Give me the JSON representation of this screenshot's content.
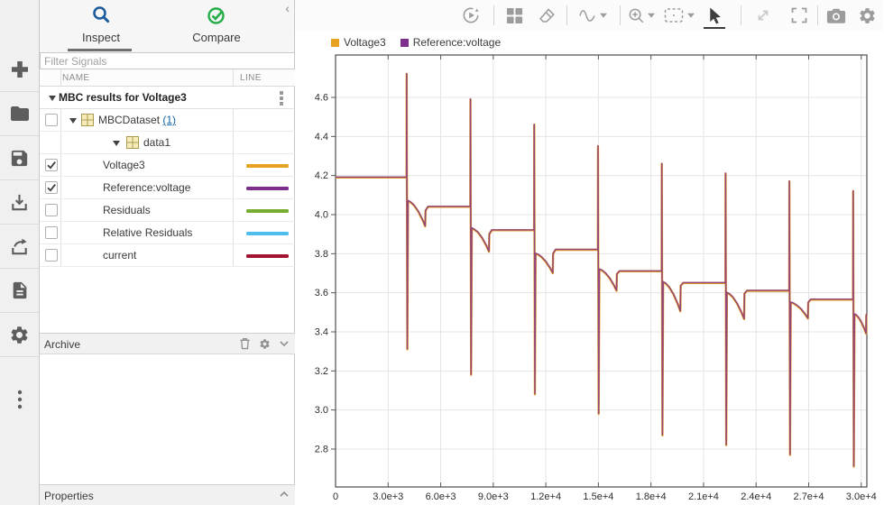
{
  "left_toolbar": {
    "icons": [
      "add",
      "open-folder",
      "save",
      "import",
      "export",
      "report",
      "preferences",
      "more-options"
    ]
  },
  "sidebar": {
    "collapse_glyph": "‹",
    "tabs": [
      {
        "label": "Inspect",
        "icon": "magnifier",
        "active": true
      },
      {
        "label": "Compare",
        "icon": "check-circle",
        "active": false
      }
    ],
    "filter": {
      "placeholder": "Filter Signals"
    },
    "columns": {
      "name": "NAME",
      "line": "LINE"
    },
    "group_label": "MBC results for Voltage3",
    "dataset": {
      "label": "MBCDataset",
      "count_link": "(1)"
    },
    "data1_label": "data1",
    "signals": [
      {
        "name": "Voltage3",
        "color": "#E8A222",
        "checked": true
      },
      {
        "name": "Reference:voltage",
        "color": "#7E2F8E",
        "checked": true
      },
      {
        "name": "Residuals",
        "color": "#77AC30",
        "checked": false
      },
      {
        "name": "Relative Residuals",
        "color": "#4DBEEE",
        "checked": false
      },
      {
        "name": "current",
        "color": "#A2142F",
        "checked": false
      }
    ],
    "archive_label": "Archive",
    "properties_label": "Properties"
  },
  "plot_toolbar": {
    "icons": [
      "replay",
      "subplot-layout",
      "eraser",
      "signal-trace",
      "zoom-in",
      "fit-to-view",
      "pointer",
      "pan-diagonal",
      "fullscreen",
      "snapshot",
      "settings"
    ]
  },
  "chart_data": {
    "type": "line",
    "title": "",
    "legend_position": "top-left",
    "grid": true,
    "legend": [
      {
        "label": "Voltage3",
        "color": "#E8A222"
      },
      {
        "label": "Reference:voltage",
        "color": "#7E2F8E"
      }
    ],
    "x_axis": {
      "min": 0,
      "max": 30320,
      "tick_step": 3000,
      "tick_labels": [
        "0",
        "3.0e+3",
        "6.0e+3",
        "9.0e+3",
        "1.2e+4",
        "1.5e+4",
        "1.8e+4",
        "2.1e+4",
        "2.4e+4",
        "2.7e+4",
        "3.0e+4"
      ]
    },
    "y_axis": {
      "min": 2.606,
      "max": 4.817,
      "tick_first": 2.8,
      "tick_step": 0.2,
      "tick_labels": [
        "2.8",
        "3.0",
        "3.2",
        "3.4",
        "3.6",
        "3.8",
        "4.0",
        "4.2",
        "4.4",
        "4.6"
      ]
    },
    "series": [
      {
        "name": "Voltage3",
        "color": "#E8A222",
        "width": 2.4,
        "opacity": 1,
        "dy": 0
      },
      {
        "name": "Reference:voltage",
        "color": "#7E2F8E",
        "width": 1.5,
        "opacity": 0.8,
        "dy": -0.5
      }
    ],
    "series_points_shared": true,
    "points": [
      [
        0,
        4.19
      ],
      [
        4050,
        4.19
      ],
      [
        4058,
        4.72
      ],
      [
        4095,
        3.31
      ],
      [
        4135,
        4.07
      ],
      [
        4282,
        4.063
      ],
      [
        4478,
        4.047
      ],
      [
        4723,
        4.015
      ],
      [
        4968,
        3.972
      ],
      [
        5115,
        3.94
      ],
      [
        5135,
        4.02
      ],
      [
        5280,
        4.04
      ],
      [
        7690,
        4.04
      ],
      [
        7698,
        4.59
      ],
      [
        7735,
        3.18
      ],
      [
        7775,
        3.93
      ],
      [
        7922,
        3.923
      ],
      [
        8118,
        3.909
      ],
      [
        8363,
        3.88
      ],
      [
        8608,
        3.84
      ],
      [
        8755,
        3.81
      ],
      [
        8775,
        3.9
      ],
      [
        8920,
        3.92
      ],
      [
        11330,
        3.92
      ],
      [
        11338,
        4.46
      ],
      [
        11375,
        3.08
      ],
      [
        11415,
        3.8
      ],
      [
        11562,
        3.795
      ],
      [
        11758,
        3.782
      ],
      [
        12003,
        3.758
      ],
      [
        12248,
        3.725
      ],
      [
        12395,
        3.7
      ],
      [
        12415,
        3.8
      ],
      [
        12560,
        3.82
      ],
      [
        14970,
        3.82
      ],
      [
        14978,
        4.35
      ],
      [
        15015,
        2.98
      ],
      [
        15055,
        3.72
      ],
      [
        15202,
        3.714
      ],
      [
        15398,
        3.7
      ],
      [
        15643,
        3.674
      ],
      [
        15888,
        3.637
      ],
      [
        16035,
        3.61
      ],
      [
        16055,
        3.695
      ],
      [
        16200,
        3.71
      ],
      [
        18610,
        3.71
      ],
      [
        18618,
        4.26
      ],
      [
        18655,
        2.87
      ],
      [
        18695,
        3.655
      ],
      [
        18842,
        3.647
      ],
      [
        19038,
        3.628
      ],
      [
        19283,
        3.592
      ],
      [
        19528,
        3.542
      ],
      [
        19675,
        3.505
      ],
      [
        19695,
        3.635
      ],
      [
        19840,
        3.65
      ],
      [
        22250,
        3.65
      ],
      [
        22258,
        4.21
      ],
      [
        22295,
        2.82
      ],
      [
        22335,
        3.6
      ],
      [
        22482,
        3.593
      ],
      [
        22678,
        3.576
      ],
      [
        22923,
        3.543
      ],
      [
        23168,
        3.498
      ],
      [
        23315,
        3.465
      ],
      [
        23335,
        3.595
      ],
      [
        23480,
        3.61
      ],
      [
        25890,
        3.61
      ],
      [
        25898,
        4.17
      ],
      [
        25935,
        2.77
      ],
      [
        25975,
        3.55
      ],
      [
        26122,
        3.546
      ],
      [
        26318,
        3.535
      ],
      [
        26563,
        3.516
      ],
      [
        26808,
        3.488
      ],
      [
        26955,
        3.468
      ],
      [
        26975,
        3.55
      ],
      [
        27120,
        3.565
      ],
      [
        29530,
        3.565
      ],
      [
        29538,
        4.12
      ],
      [
        29575,
        2.71
      ],
      [
        29615,
        3.49
      ],
      [
        29714,
        3.485
      ],
      [
        29846,
        3.472
      ],
      [
        30011,
        3.448
      ],
      [
        30176,
        3.415
      ],
      [
        30275,
        3.39
      ],
      [
        30285,
        3.48
      ],
      [
        30300,
        3.49
      ]
    ]
  }
}
